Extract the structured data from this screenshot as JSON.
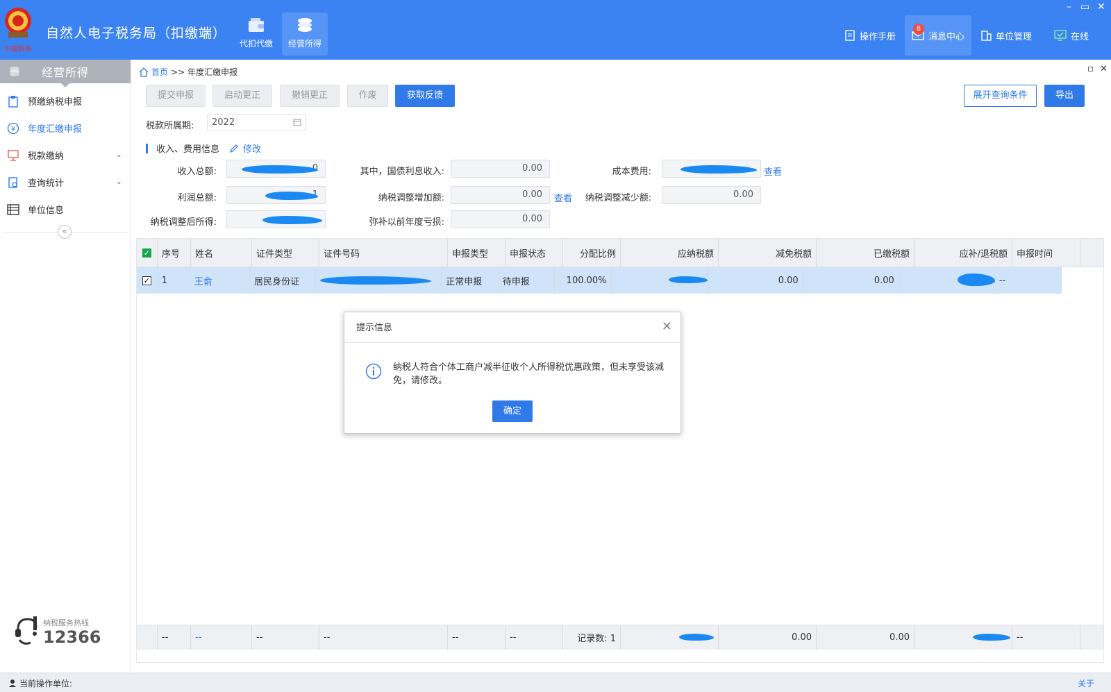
{
  "header": {
    "title": "自然人电子税务局（扣缴端）",
    "logo_text": "中国税务",
    "nav": [
      {
        "label": "代扣代缴",
        "icon": "wallet-icon"
      },
      {
        "label": "经营所得",
        "icon": "coins-icon"
      }
    ],
    "right": [
      {
        "label": "操作手册",
        "icon": "manual-icon"
      },
      {
        "label": "消息中心",
        "icon": "mail-icon",
        "badge": "8"
      },
      {
        "label": "单位管理",
        "icon": "building-icon"
      },
      {
        "label": "在线",
        "icon": "online-icon"
      }
    ]
  },
  "sidebar": {
    "title": "经营所得",
    "items": [
      {
        "label": "预缴纳税申报",
        "icon": "clipboard-icon"
      },
      {
        "label": "年度汇缴申报",
        "icon": "yen-icon"
      },
      {
        "label": "税款缴纳",
        "icon": "payment-icon"
      },
      {
        "label": "查询统计",
        "icon": "query-icon"
      },
      {
        "label": "单位信息",
        "icon": "list-icon"
      }
    ],
    "collapse": "«",
    "hotline_label": "纳税服务热线",
    "hotline_number": "12366"
  },
  "breadcrumb": {
    "home": "首页",
    "sep": ">>",
    "current": "年度汇缴申报"
  },
  "toolbar": {
    "submit": "提交申报",
    "start_correct": "启动更正",
    "cancel_correct": "撤销更正",
    "void": "作废",
    "feedback": "获取反馈",
    "expand_query": "展开查询条件",
    "export": "导出"
  },
  "period": {
    "label": "税款所属期:",
    "value": "2022"
  },
  "section": {
    "title": "收入、费用信息",
    "edit": "修改"
  },
  "form": {
    "total_income": {
      "label": "收入总额:",
      "value": "0"
    },
    "bond_interest": {
      "label": "其中，国债利息收入:",
      "value": "0.00"
    },
    "cost": {
      "label": "成本费用:",
      "view": "查看"
    },
    "total_profit": {
      "label": "利润总额:",
      "value": "1"
    },
    "adj_increase": {
      "label": "纳税调整增加额:",
      "value": "0.00",
      "view": "查看"
    },
    "adj_decrease": {
      "label": "纳税调整减少额:",
      "value": "0.00"
    },
    "adjusted_income": {
      "label": "纳税调整后所得:"
    },
    "prior_loss": {
      "label": "弥补以前年度亏损:",
      "value": "0.00"
    }
  },
  "table": {
    "headers": [
      "序号",
      "姓名",
      "证件类型",
      "证件号码",
      "申报类型",
      "申报状态",
      "分配比例",
      "应纳税额",
      "减免税额",
      "已缴税额",
      "应补/退税额",
      "申报时间"
    ],
    "rows": [
      {
        "seq": "1",
        "name": "王俞",
        "id_type": "居民身份证",
        "id_no": "",
        "decl_type": "正常申报",
        "status": "待申报",
        "ratio": "100.00%",
        "tax_due": "",
        "relief": "0.00",
        "paid": "0.00",
        "refund": "",
        "time": "--"
      }
    ],
    "footer": {
      "seq": "--",
      "name": "--",
      "id_type": "--",
      "id_no": "--",
      "decl_type": "--",
      "status": "--",
      "count": "记录数: 1",
      "relief": "0.00",
      "paid": "0.00",
      "time": "--"
    }
  },
  "modal": {
    "title": "提示信息",
    "message": "纳税人符合个体工商户减半征收个人所得税优惠政策，但未享受该减免，请修改。",
    "ok": "确定"
  },
  "statusbar": {
    "text": "当前操作单位:",
    "about": "关于"
  },
  "colors": {
    "header": "#3b82f2",
    "primary": "#2f7ae8",
    "selected_row": "#cfe3f9",
    "redaction": "#1a8af2"
  }
}
